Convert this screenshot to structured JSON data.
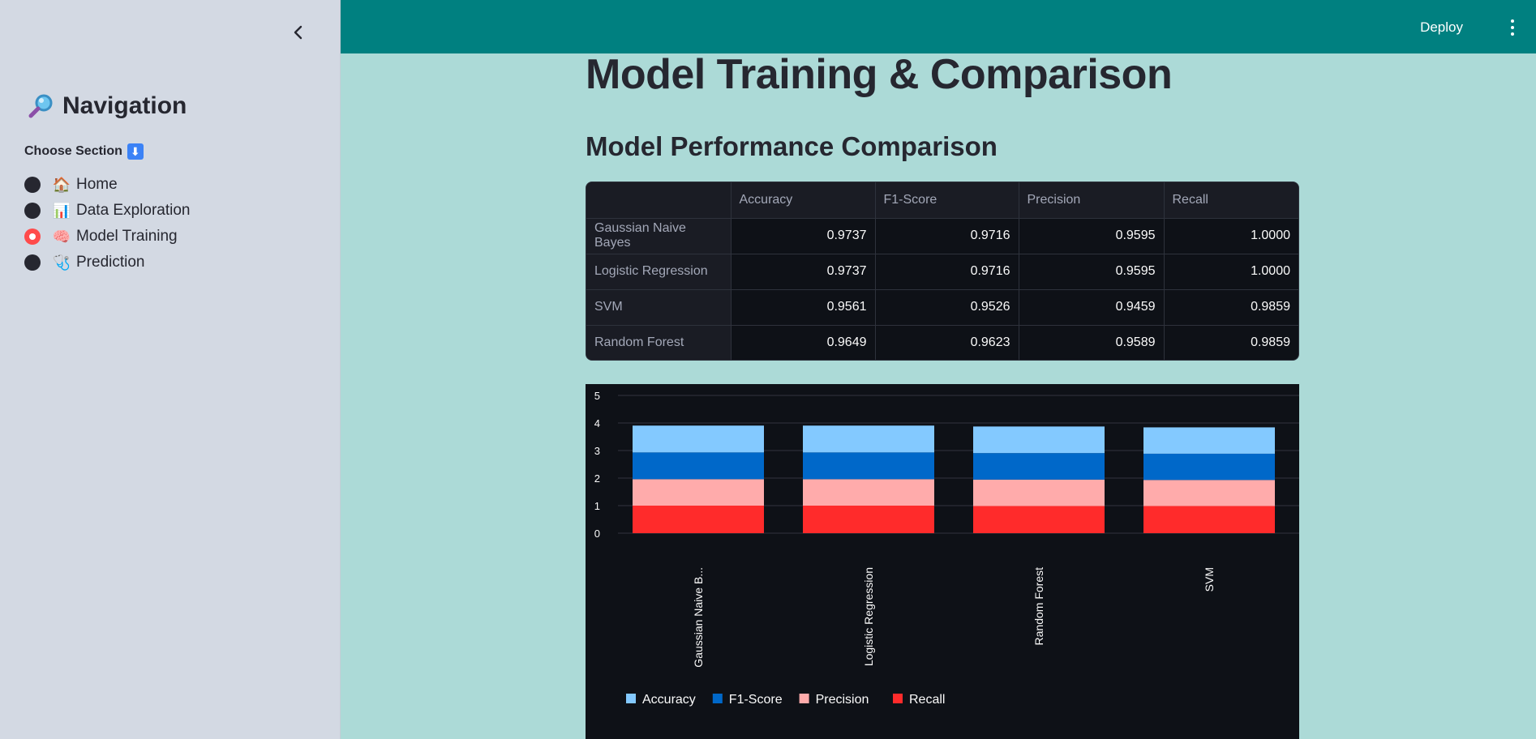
{
  "sidebar": {
    "title": "Navigation",
    "title_icon": "magnifier-icon",
    "choose_label": "Choose Section",
    "choose_icon": "down-arrow-icon",
    "items": [
      {
        "emoji": "🏠",
        "label": "Home",
        "selected": false
      },
      {
        "emoji": "📊",
        "label": "Data Exploration",
        "selected": false
      },
      {
        "emoji": "🧠",
        "label": "Model Training",
        "selected": true
      },
      {
        "emoji": "🩺",
        "label": "Prediction",
        "selected": false
      }
    ]
  },
  "header": {
    "deploy_label": "Deploy",
    "bg_color": "#008080"
  },
  "main": {
    "page_title": "Model Training & Comparison",
    "section_title": "Model Performance Comparison",
    "table": {
      "columns": [
        "",
        "Accuracy",
        "F1-Score",
        "Precision",
        "Recall"
      ],
      "rows": [
        [
          "Gaussian Naive Bayes",
          "0.9737",
          "0.9716",
          "0.9595",
          "1.0000"
        ],
        [
          "Logistic Regression",
          "0.9737",
          "0.9716",
          "0.9595",
          "1.0000"
        ],
        [
          "SVM",
          "0.9561",
          "0.9526",
          "0.9459",
          "0.9859"
        ],
        [
          "Random Forest",
          "0.9649",
          "0.9623",
          "0.9589",
          "0.9859"
        ]
      ]
    }
  },
  "chart_data": {
    "type": "bar",
    "stacked": true,
    "categories": [
      "Gaussian Naive B...",
      "Logistic Regression",
      "Random Forest",
      "SVM"
    ],
    "series": [
      {
        "name": "Recall",
        "values": [
          1.0,
          1.0,
          0.9859,
          0.9859
        ],
        "color": "#ff2b2b"
      },
      {
        "name": "Precision",
        "values": [
          0.9595,
          0.9595,
          0.9589,
          0.9459
        ],
        "color": "#ffabab"
      },
      {
        "name": "F1-Score",
        "values": [
          0.9716,
          0.9716,
          0.9623,
          0.9526
        ],
        "color": "#0068c9"
      },
      {
        "name": "Accuracy",
        "values": [
          0.9737,
          0.9737,
          0.9649,
          0.9561
        ],
        "color": "#83c9ff"
      }
    ],
    "legend_order": [
      "Accuracy",
      "F1-Score",
      "Precision",
      "Recall"
    ],
    "yticks": [
      "0",
      "1",
      "2",
      "3",
      "4",
      "5"
    ],
    "ylim": [
      0,
      5
    ],
    "grid": true,
    "legend_position": "bottom-left"
  }
}
